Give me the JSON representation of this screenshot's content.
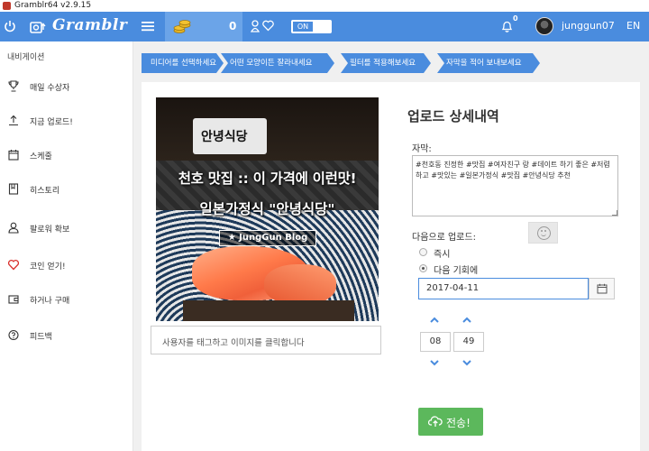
{
  "window": {
    "title": "Gramblr64 v2.9.15"
  },
  "topbar": {
    "logo": "Gramblr",
    "coins": "0",
    "toggle_label": "ON",
    "notification_count": "0",
    "username": "junggun07",
    "language": "EN"
  },
  "sidebar": {
    "header": "내비게이션",
    "items": [
      {
        "label": "매일 수상자",
        "icon": "trophy-icon"
      },
      {
        "label": "지금 업로드!",
        "icon": "upload-icon"
      },
      {
        "label": "스케줄",
        "icon": "calendar-icon"
      },
      {
        "label": "히스토리",
        "icon": "bookmark-icon"
      },
      {
        "label": "팔로워 확보",
        "icon": "user-icon"
      },
      {
        "label": "코인 얻기!",
        "icon": "heart-icon"
      },
      {
        "label": "하거나 구매",
        "icon": "wallet-icon"
      },
      {
        "label": "피드백",
        "icon": "question-icon"
      }
    ]
  },
  "steps": [
    "미디어를 선택하세요",
    "어떤 모양이든 잘라내세요",
    "필터를 적용해보세요",
    "자막을 적어 보내보세요"
  ],
  "image": {
    "sign_text": "안녕식당",
    "title_line1": "천호 맛집 :: 이 가격에 이런맛!",
    "title_line2": "일본가정식 \"안녕식당\"",
    "banner": "★ JungGun Blog"
  },
  "tag_input": {
    "placeholder": "사용자를 태그하고 이미지를 클릭합니다"
  },
  "details": {
    "title": "업로드 상세내역",
    "caption_label": "자막:",
    "caption_value": "#천호동 진정한 #맛집 #여자친구 랑 #데이트 하기 좋은 #저렴하고 #맛있는 #일본가정식 #맛집 #안녕식당 추천",
    "upload_label": "다음으로 업로드:",
    "option_now": "즉시",
    "option_later": "다음 기회에",
    "selected_option": "later",
    "date": "2017-04-11",
    "hour": "08",
    "minute": "49",
    "time_separator": ":",
    "send_label": "전송!"
  },
  "colors": {
    "brand_blue": "#4a8cde",
    "send_green": "#5cb85c",
    "coin_area": "#6ba4e8"
  }
}
